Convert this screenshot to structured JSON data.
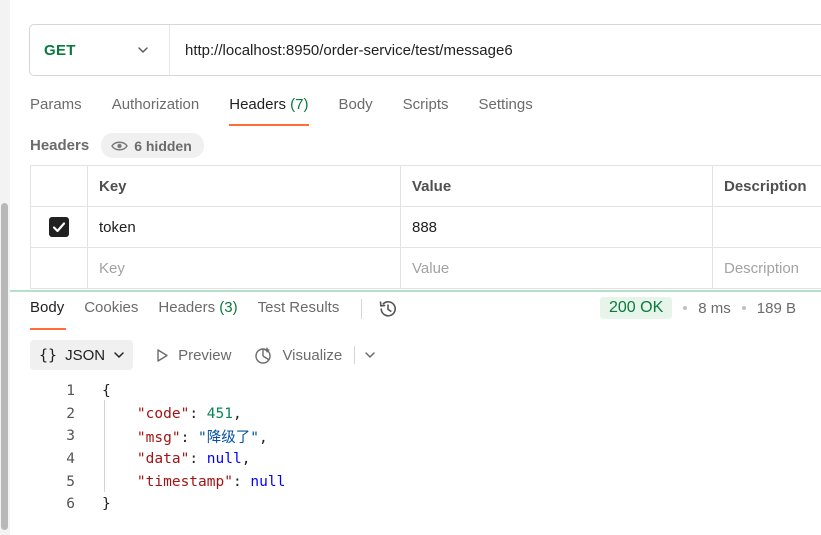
{
  "request": {
    "method": "GET",
    "url": "http://localhost:8950/order-service/test/message6"
  },
  "request_tabs": [
    {
      "label": "Params",
      "count": ""
    },
    {
      "label": "Authorization",
      "count": ""
    },
    {
      "label": "Headers",
      "count": "(7)"
    },
    {
      "label": "Body",
      "count": ""
    },
    {
      "label": "Scripts",
      "count": ""
    },
    {
      "label": "Settings",
      "count": ""
    }
  ],
  "headers_section": {
    "title": "Headers",
    "hidden_label": "6 hidden",
    "columns": {
      "key": "Key",
      "value": "Value",
      "description": "Description"
    },
    "rows": [
      {
        "key": "token",
        "value": "888",
        "description": "",
        "checked": true
      }
    ],
    "placeholders": {
      "key": "Key",
      "value": "Value",
      "description": "Description"
    }
  },
  "response_tabs": [
    {
      "label": "Body",
      "count": ""
    },
    {
      "label": "Cookies",
      "count": ""
    },
    {
      "label": "Headers",
      "count": "(3)"
    },
    {
      "label": "Test Results",
      "count": ""
    }
  ],
  "response_status": {
    "status": "200 OK",
    "time": "8 ms",
    "size": "189 B"
  },
  "response_toolbar": {
    "format_braces": "{}",
    "format_label": "JSON",
    "preview_label": "Preview",
    "visualize_label": "Visualize"
  },
  "code": {
    "line_numbers": [
      "1",
      "2",
      "3",
      "4",
      "5",
      "6"
    ],
    "open_brace": "{",
    "close_brace": "}",
    "fields": [
      {
        "key": "\"code\"",
        "value": "451",
        "type": "number",
        "trail": ","
      },
      {
        "key": "\"msg\"",
        "value": "\"降级了\"",
        "type": "string",
        "trail": ","
      },
      {
        "key": "\"data\"",
        "value": "null",
        "type": "null",
        "trail": ","
      },
      {
        "key": "\"timestamp\"",
        "value": "null",
        "type": "null",
        "trail": ""
      }
    ]
  },
  "colors": {
    "accent": "#ff6c37",
    "method_get": "#0b7a3e",
    "status_ok_bg": "#e6f4ea"
  },
  "icons": [
    "chevron-down-icon",
    "eye-icon",
    "checkmark-icon",
    "history-icon",
    "play-icon",
    "visualize-icon"
  ]
}
